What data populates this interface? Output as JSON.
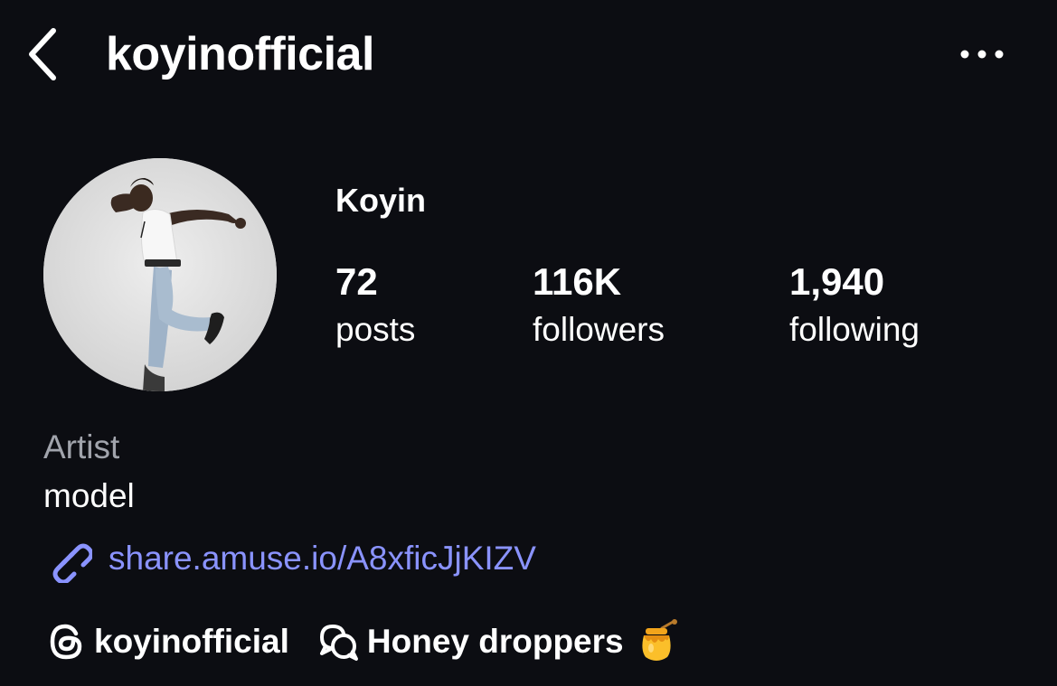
{
  "header": {
    "username": "koyinofficial",
    "back_icon": "chevron-left-icon",
    "more_icon": "more-horizontal-icon"
  },
  "profile": {
    "display_name": "Koyin",
    "avatar_icon": "profile-photo",
    "stats": [
      {
        "value": "72",
        "label": "posts"
      },
      {
        "value": "116K",
        "label": "followers"
      },
      {
        "value": "1,940",
        "label": "following"
      }
    ],
    "category": "Artist",
    "bio": "model",
    "link": {
      "icon": "link-icon",
      "text": "share.amuse.io/A8xficJjKIZV"
    },
    "chips": [
      {
        "icon": "threads-icon",
        "label": "koyinofficial"
      },
      {
        "icon": "chat-bubbles-icon",
        "label": "Honey droppers",
        "emoji": "honey-pot-icon"
      }
    ]
  },
  "colors": {
    "background": "#0c0d12",
    "text": "#ffffff",
    "secondary_text": "#a1a4ac",
    "link": "#8a93ff"
  }
}
